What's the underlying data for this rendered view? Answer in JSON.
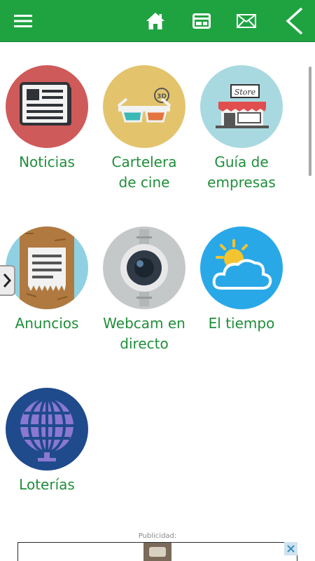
{
  "topbar": {
    "bg_color": "#1fa341",
    "icons": [
      "menu-icon",
      "home-icon",
      "window-icon",
      "mail-icon",
      "back-icon"
    ]
  },
  "grid": {
    "items": [
      {
        "label": "Noticias",
        "icon": "newspaper-icon",
        "bg": "#cf5a5a"
      },
      {
        "label": "Cartelera\nde cine",
        "icon": "3d-glasses-icon",
        "bg": "#e3c46c"
      },
      {
        "label": "Guía de\nempresas",
        "icon": "store-icon",
        "bg": "#a9d9e0"
      },
      {
        "label": "Anuncios",
        "icon": "posted-notice-icon",
        "bg": "#8fd1e2"
      },
      {
        "label": "Webcam en\ndirecto",
        "icon": "webcam-icon",
        "bg": "#c5c8c9"
      },
      {
        "label": "El tiempo",
        "icon": "weather-icon",
        "bg": "#29a8e8"
      },
      {
        "label": "Loterías",
        "icon": "lottery-globe-icon",
        "bg": "#1f4a8c"
      }
    ],
    "label_color": "#1f8e3a"
  },
  "ad": {
    "label": "Publicidad:"
  }
}
